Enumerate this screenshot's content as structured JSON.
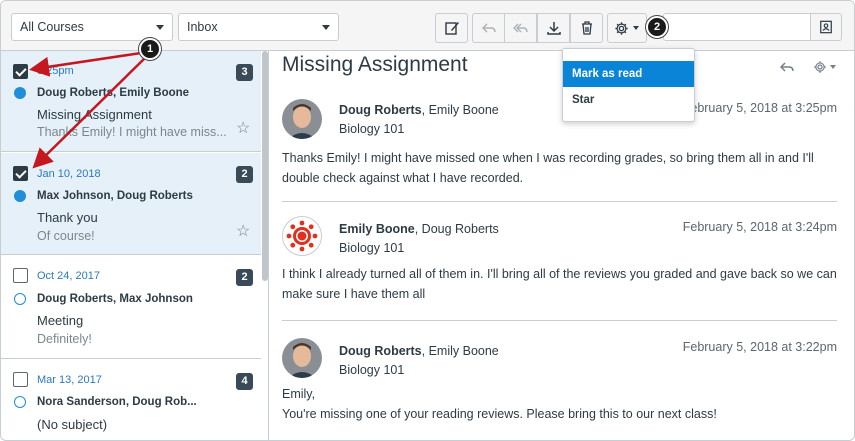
{
  "toolbar": {
    "course_filter": "All Courses",
    "mailbox_filter": "Inbox"
  },
  "conversations": [
    {
      "date": "3:25pm",
      "participants": "Doug Roberts, Emily Boone",
      "subject": "Missing Assignment",
      "preview": "Thanks Emily! I might have miss...",
      "count": "3",
      "checked": true,
      "unread": true,
      "starred": false
    },
    {
      "date": "Jan 10, 2018",
      "participants": "Max Johnson, Doug Roberts",
      "subject": "Thank you",
      "preview": "Of course!",
      "count": "2",
      "checked": true,
      "unread": true,
      "starred": false
    },
    {
      "date": "Oct 24, 2017",
      "participants": "Doug Roberts, Max Johnson",
      "subject": "Meeting",
      "preview": "Definitely!",
      "count": "2",
      "checked": false,
      "unread": false
    },
    {
      "date": "Mar 13, 2017",
      "participants": "Nora Sanderson, Doug Rob...",
      "subject": "(No subject)",
      "preview": "",
      "count": "4",
      "checked": false,
      "unread": false
    }
  ],
  "thread": {
    "title": "Missing Assignment",
    "messages": [
      {
        "author": "Doug Roberts",
        "others": ", Emily Boone",
        "course": "Biology 101",
        "date": "February 5, 2018 at 3:25pm",
        "body": "Thanks Emily! I might have missed one when I was recording grades, so bring them all in and I'll double check against what I have recorded.",
        "avatar": "photo"
      },
      {
        "author": "Emily Boone",
        "others": ", Doug Roberts",
        "course": "Biology 101",
        "date": "February 5, 2018 at 3:24pm",
        "body": "I think I already turned all of them in. I'll bring all of the reviews you graded and gave back so we can make sure I have them all",
        "avatar": "logo"
      },
      {
        "author": "Doug Roberts",
        "others": ", Emily Boone",
        "course": "Biology 101",
        "date": "February 5, 2018 at 3:22pm",
        "body_line1": "Emily,",
        "body_line2": "You're missing one of your reading reviews. Please bring this to our next class!",
        "avatar": "photo"
      }
    ]
  },
  "settings_menu": {
    "items": [
      "Mark as read",
      "Star"
    ]
  },
  "callouts": [
    "1",
    "2"
  ],
  "colors": {
    "accent": "#0a84d6",
    "unread_dot": "#1e8fd8",
    "selected_row": "#e5f0f8"
  }
}
